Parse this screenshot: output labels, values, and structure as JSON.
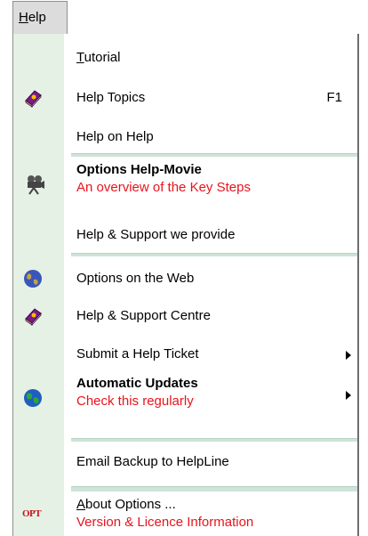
{
  "menu": {
    "title_mnemonic": "H",
    "title_rest": "elp"
  },
  "items": {
    "tutorial": {
      "mnemonic": "T",
      "rest": "utorial"
    },
    "help_topics": {
      "label": "Help Topics",
      "shortcut": "F1"
    },
    "help_on_help": {
      "label": "Help on Help"
    },
    "options_help_movie": {
      "label": "Options Help-Movie",
      "sublabel": "An overview of the Key Steps"
    },
    "help_support_provide": {
      "label": "Help & Support we provide"
    },
    "options_on_web": {
      "label": "Options on the Web"
    },
    "help_support_centre": {
      "label": "Help & Support Centre"
    },
    "submit_ticket": {
      "label": "Submit a Help Ticket"
    },
    "automatic_updates": {
      "label": "Automatic Updates",
      "sublabel": "Check this regularly"
    },
    "email_backup": {
      "label": "Email Backup to HelpLine"
    },
    "about_options": {
      "mnemonic": "A",
      "rest": "bout Options  ...",
      "sublabel": "Version & Licence Information"
    }
  },
  "icons": {
    "book": "help-book-icon",
    "camera": "movie-camera-icon",
    "globe": "globe-icon",
    "logo": "opt-logo-icon",
    "logo_text": "OPT"
  },
  "colors": {
    "accent_red": "#e8141c",
    "gutter": "#e6f1e6",
    "separator": "#cfe3d7"
  }
}
